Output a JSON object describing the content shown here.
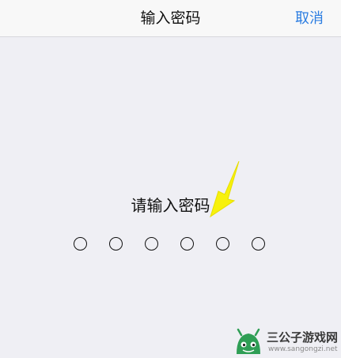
{
  "navbar": {
    "title": "输入密码",
    "cancel_label": "取消",
    "accent_color": "#2b7de1"
  },
  "passcode": {
    "prompt": "请输入密码",
    "digits_total": 6,
    "digits_entered": 0
  },
  "annotation": {
    "arrow_icon": "yellow-arrow-icon",
    "arrow_color": "#f7f10c"
  },
  "watermark": {
    "title": "三公子游戏网",
    "url": "www.sangongzi.net",
    "logo_icon": "android-robot-icon"
  }
}
